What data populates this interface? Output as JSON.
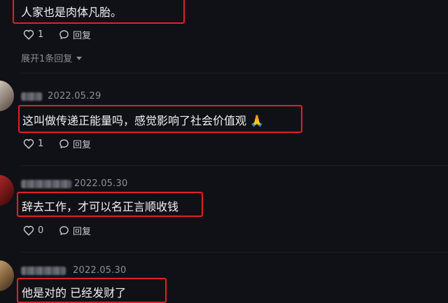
{
  "comments": [
    {
      "text": "人家也是肉体凡胎。",
      "likes": "1",
      "reply_label": "回复",
      "expand_label": "展开1条回复"
    },
    {
      "date": "2022.05.29",
      "text": "这叫做传递正能量吗，感觉影响了社会价值观 🙏",
      "likes": "1",
      "reply_label": "回复"
    },
    {
      "date": "2022.05.30",
      "text": "辞去工作，才可以名正言顺收钱",
      "likes": "0",
      "reply_label": "回复"
    },
    {
      "date": "2022.05.30",
      "text": "他是对的 已经发财了"
    }
  ],
  "colors": {
    "background": "#101116",
    "highlight_border": "#e0202a",
    "text_primary": "#f2f2f4",
    "text_secondary": "#8f9097"
  },
  "icons": {
    "like": "heart-icon",
    "reply": "reply-bubble-icon",
    "expand": "caret-down-icon"
  }
}
